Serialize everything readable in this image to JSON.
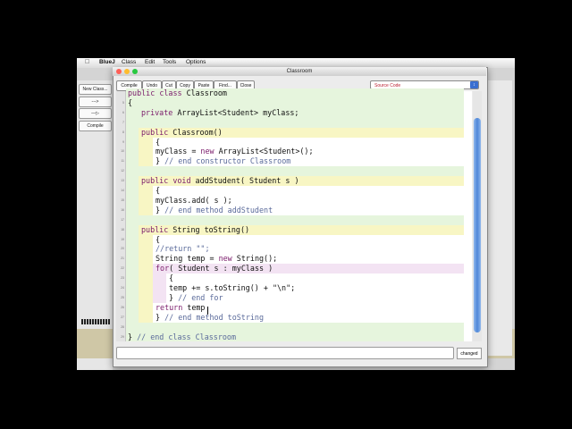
{
  "menubar": {
    "apple": "",
    "items": [
      "BlueJ",
      "Class",
      "Edit",
      "Tools",
      "Options"
    ]
  },
  "main_window": {
    "buttons": [
      "New Class...",
      "--->",
      "—▷",
      "Compile"
    ]
  },
  "editor": {
    "title": "Classroom",
    "toolbar": [
      "Compile",
      "Undo",
      "Cut",
      "Copy",
      "Paste",
      "Find...",
      "Close"
    ],
    "view_select": "Source Code",
    "status_flag": "changed",
    "line_numbers": [
      "5",
      "6",
      "7",
      "8",
      "9",
      "10",
      "11",
      "12",
      "13",
      "14",
      "15",
      "16",
      "17",
      "18",
      "19",
      "20",
      "21",
      "22",
      "23",
      "24",
      "25",
      "26",
      "27",
      "28",
      "29"
    ],
    "lines": [
      {
        "indent": 0,
        "text": "public class Classroom"
      },
      {
        "indent": 0,
        "text": "{"
      },
      {
        "indent": 1,
        "text": "private ArrayList<Student> myClass;"
      },
      {
        "indent": 0,
        "text": ""
      },
      {
        "indent": 1,
        "text": "public Classroom()"
      },
      {
        "indent": 2,
        "text": "{"
      },
      {
        "indent": 2,
        "text": "myClass = new ArrayList<Student>();"
      },
      {
        "indent": 2,
        "text": "} // end constructor Classroom"
      },
      {
        "indent": 0,
        "text": ""
      },
      {
        "indent": 1,
        "text": "public void addStudent( Student s )"
      },
      {
        "indent": 2,
        "text": "{"
      },
      {
        "indent": 2,
        "text": "myClass.add( s );"
      },
      {
        "indent": 2,
        "text": "} // end method addStudent"
      },
      {
        "indent": 0,
        "text": ""
      },
      {
        "indent": 1,
        "text": "public String toString()"
      },
      {
        "indent": 2,
        "text": "{"
      },
      {
        "indent": 2,
        "text": "//return \"\";"
      },
      {
        "indent": 2,
        "text": "String temp = new String();"
      },
      {
        "indent": 2,
        "text": "for( Student s : myClass )"
      },
      {
        "indent": 3,
        "text": "{"
      },
      {
        "indent": 3,
        "text": "temp += s.toString() + \"\\n\";"
      },
      {
        "indent": 3,
        "text": "} // end for"
      },
      {
        "indent": 2,
        "text": "return temp"
      },
      {
        "indent": 2,
        "text": "} // end method toString"
      },
      {
        "indent": 0,
        "text": ""
      },
      {
        "indent": 0,
        "text": "} // end class Classroom"
      }
    ]
  },
  "colors": {
    "class_scope": "#e6f5dd",
    "method_scope": "#f8f6c4",
    "method_header": "#f2f0a8",
    "loop_scope": "#f3e3f3",
    "body_white": "#ffffff",
    "accent": "#4f87d8"
  },
  "icons": {
    "apple": "apple-icon",
    "close": "close-icon",
    "minimize": "minimize-icon",
    "zoom": "zoom-icon",
    "select": "chevron-updown-icon"
  }
}
